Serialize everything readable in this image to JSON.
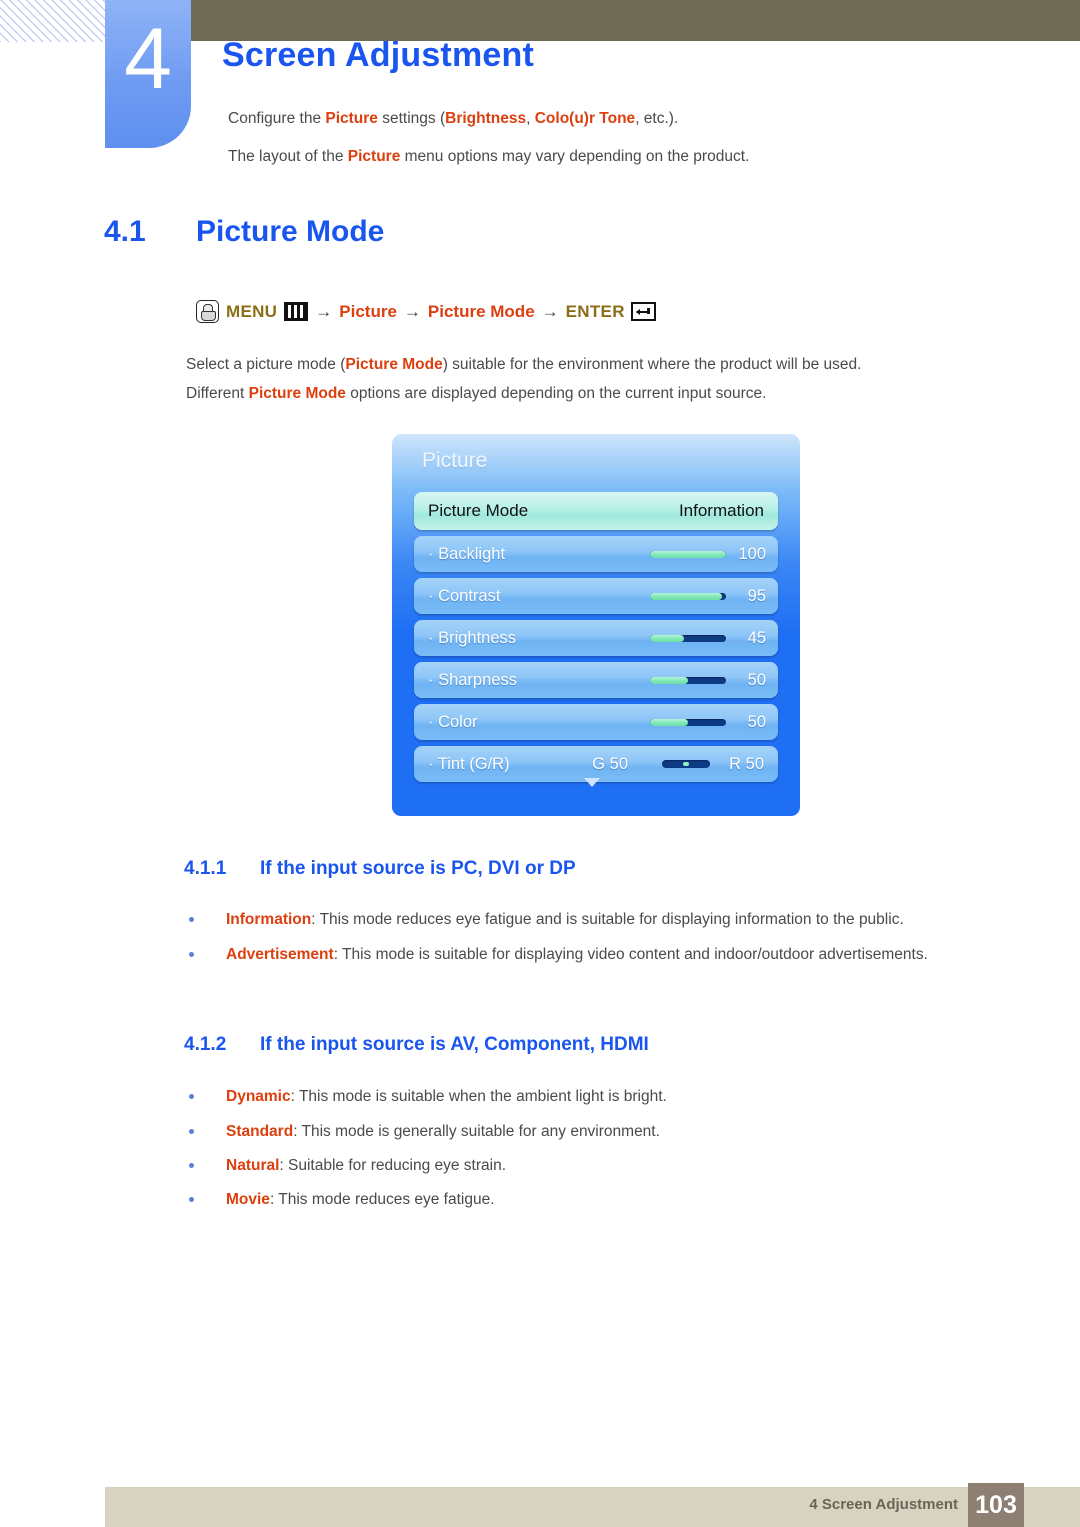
{
  "header": {
    "chapter_number": "4",
    "chapter_title": "Screen Adjustment",
    "intro_line_1_pre": "Configure the ",
    "intro_line_1_kw1": "Picture",
    "intro_line_1_mid": " settings (",
    "intro_line_1_kw2": "Brightness",
    "intro_line_1_sep": ", ",
    "intro_line_1_kw3": "Colo(u)r Tone",
    "intro_line_1_post": ", etc.).",
    "intro_line_2_pre": "The layout of the ",
    "intro_line_2_kw": "Picture",
    "intro_line_2_post": " menu options may vary depending on the product."
  },
  "section": {
    "number": "4.1",
    "title": "Picture Mode"
  },
  "menu_path": {
    "hand_icon": "hand-press-icon",
    "menu_label": "MENU",
    "menu_bars_icon": "menu-bars-icon",
    "arrow": "→",
    "step_picture": "Picture",
    "step_picture_mode": "Picture Mode",
    "enter_label": "ENTER",
    "enter_icon": "enter-key-icon"
  },
  "paragraphs": {
    "p1_pre": "Select a picture mode (",
    "p1_kw": "Picture Mode",
    "p1_post": ") suitable for the environment where the product will be used.",
    "p2_pre": "Different ",
    "p2_kw": "Picture Mode",
    "p2_post": " options are displayed depending on the current input source."
  },
  "osd": {
    "title": "Picture",
    "scroll_down_icon": "chevron-down-icon",
    "rows": [
      {
        "label": "Picture Mode",
        "value": "Information",
        "type": "select",
        "selected": true
      },
      {
        "label": "· Backlight",
        "value": "100",
        "type": "slider",
        "fill_pct": 100,
        "selected": false
      },
      {
        "label": "· Contrast",
        "value": "95",
        "type": "slider",
        "fill_pct": 95,
        "selected": false
      },
      {
        "label": "· Brightness",
        "value": "45",
        "type": "slider",
        "fill_pct": 45,
        "selected": false
      },
      {
        "label": "· Sharpness",
        "value": "50",
        "type": "slider",
        "fill_pct": 50,
        "selected": false
      },
      {
        "label": "· Color",
        "value": "50",
        "type": "slider",
        "fill_pct": 50,
        "selected": false
      },
      {
        "label": "· Tint (G/R)",
        "type": "tint",
        "green": "G 50",
        "red": "R 50",
        "knob_pct": 50,
        "selected": false
      }
    ]
  },
  "subsections": [
    {
      "number": "4.1.1",
      "title": "If the input source is PC, DVI or DP",
      "bullets": [
        {
          "kw": "Information",
          "text": ": This mode reduces eye fatigue and is suitable for displaying information to the public."
        },
        {
          "kw": "Advertisement",
          "text": ": This mode is suitable for displaying video content and indoor/outdoor advertisements."
        }
      ]
    },
    {
      "number": "4.1.2",
      "title": "If the input source is AV, Component, HDMI",
      "bullets": [
        {
          "kw": "Dynamic",
          "text": ": This mode is suitable when the ambient light is bright."
        },
        {
          "kw": "Standard",
          "text": ": This mode is generally suitable for any environment."
        },
        {
          "kw": "Natural",
          "text": ": Suitable for reducing eye strain."
        },
        {
          "kw": "Movie",
          "text": ": This mode reduces eye fatigue."
        }
      ]
    }
  ],
  "footer": {
    "text": "4 Screen Adjustment",
    "page_number": "103"
  },
  "colors": {
    "keyword_orange": "#dd3f0e",
    "heading_blue": "#1a55f0",
    "menu_gold": "#8a6f18",
    "header_olive": "#6d6b56",
    "footer_beige": "#d8d3c0",
    "footer_page_taupe": "#8d7f72",
    "osd_blue": "#1f6ff4",
    "osd_slider_green": "#7fe8b6",
    "osd_slider_track": "#0d3a85"
  }
}
